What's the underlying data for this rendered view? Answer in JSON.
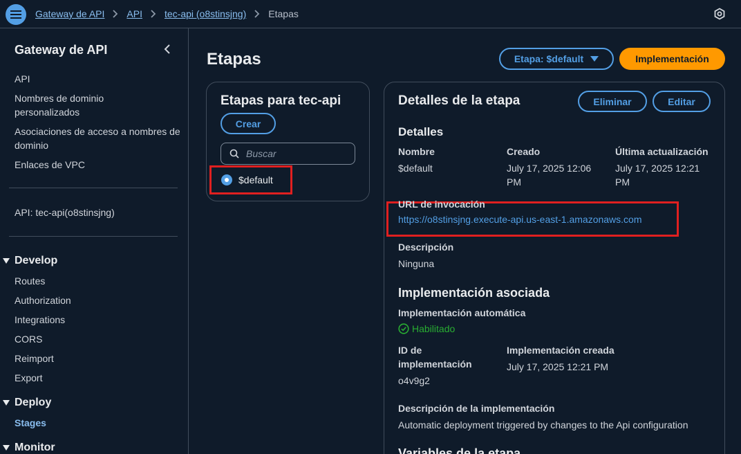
{
  "breadcrumb": {
    "items": [
      "Gateway de API",
      "API",
      "tec-api (o8stinsjng)"
    ],
    "current": "Etapas"
  },
  "sidebar": {
    "title": "Gateway de API",
    "links": [
      "API",
      "Nombres de dominio personalizados",
      "Asociaciones de acceso a nombres de dominio",
      "Enlaces de VPC"
    ],
    "api_label": "API: tec-api(o8stinsjng)",
    "develop": {
      "label": "Develop",
      "items": [
        "Routes",
        "Authorization",
        "Integrations",
        "CORS",
        "Reimport",
        "Export"
      ]
    },
    "deploy": {
      "label": "Deploy",
      "items": [
        "Stages"
      ]
    },
    "monitor": {
      "label": "Monitor"
    }
  },
  "page": {
    "title": "Etapas",
    "stage_select": "Etapa: $default",
    "deploy_button": "Implementación"
  },
  "stages_panel": {
    "title": "Etapas para tec-api",
    "create_button": "Crear",
    "search_placeholder": "Buscar",
    "stages": [
      "$default"
    ]
  },
  "details": {
    "title": "Detalles de la etapa",
    "delete_button": "Eliminar",
    "edit_button": "Editar",
    "section_title": "Detalles",
    "name_label": "Nombre",
    "name_value": "$default",
    "created_label": "Creado",
    "created_value": "July 17, 2025 12:06 PM",
    "updated_label": "Última actualización",
    "updated_value": "July 17, 2025 12:21 PM",
    "url_label": "URL de invocación",
    "url_value": "https://o8stinsjng.execute-api.us-east-1.amazonaws.com",
    "desc_label": "Descripción",
    "desc_value": "Ninguna",
    "deployment_section": "Implementación asociada",
    "auto_label": "Implementación automática",
    "auto_value": "Habilitado",
    "deploy_id_label": "ID de implementación",
    "deploy_id_value": "o4v9g2",
    "deploy_created_label": "Implementación creada",
    "deploy_created_value": "July 17, 2025 12:21 PM",
    "deploy_desc_label": "Descripción de la implementación",
    "deploy_desc_value": "Automatic deployment triggered by changes to the Api configuration",
    "variables_section": "Variables de la etapa"
  },
  "colors": {
    "background": "#0f1b2a",
    "link": "#539fe5",
    "primary": "#ff9900",
    "highlight": "#e02020",
    "success": "#29ad32"
  }
}
